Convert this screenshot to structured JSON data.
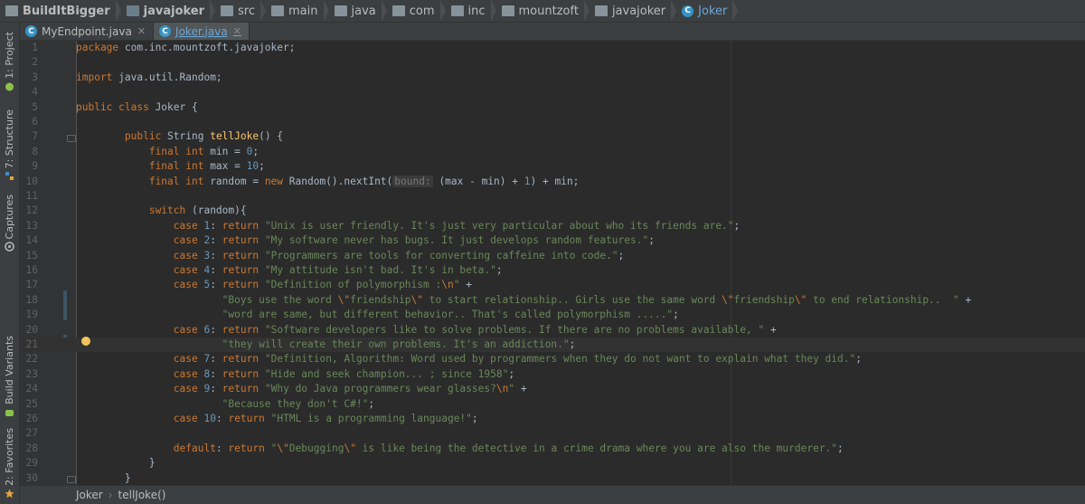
{
  "breadcrumb": [
    {
      "label": "BuildItBigger",
      "icon": "project-folder-icon",
      "bold": true
    },
    {
      "label": "javajoker",
      "icon": "module-folder-icon",
      "bold": true
    },
    {
      "label": "src",
      "icon": "folder-icon"
    },
    {
      "label": "main",
      "icon": "folder-icon"
    },
    {
      "label": "java",
      "icon": "folder-icon"
    },
    {
      "label": "com",
      "icon": "folder-icon"
    },
    {
      "label": "inc",
      "icon": "folder-icon"
    },
    {
      "label": "mountzoft",
      "icon": "package-folder-icon"
    },
    {
      "label": "javajoker",
      "icon": "package-folder-icon"
    },
    {
      "label": "Joker",
      "icon": "class-icon"
    }
  ],
  "side_tabs": [
    "1: Project",
    "7: Structure",
    "Captures",
    "Build Variants",
    "2: Favorites"
  ],
  "tabs": [
    {
      "label": "MyEndpoint.java",
      "active": false
    },
    {
      "label": "Joker.java",
      "active": true
    }
  ],
  "editor": {
    "lines": [
      {
        "n": "1",
        "html": "<span class=\"kw\">package</span> com.inc.mountzoft.javajoker;"
      },
      {
        "n": "2",
        "html": ""
      },
      {
        "n": "3",
        "html": "<span class=\"kw\">import</span> java.util.Random;"
      },
      {
        "n": "4",
        "html": ""
      },
      {
        "n": "5",
        "html": "<span class=\"kw\">public class</span> Joker {"
      },
      {
        "n": "6",
        "html": ""
      },
      {
        "n": "7",
        "html": "        <span class=\"kw\">public</span> String <span class=\"fn\">tellJoke</span>() {"
      },
      {
        "n": "8",
        "html": "            <span class=\"kw\">final int</span> min = <span class=\"num\">0</span>;"
      },
      {
        "n": "9",
        "html": "            <span class=\"kw\">final int</span> max = <span class=\"num\">10</span>;"
      },
      {
        "n": "10",
        "html": "            <span class=\"kw\">final int</span> random = <span class=\"kw\">new</span> Random().nextInt(<span class=\"hint\">bound:</span> (max - min) + <span class=\"num\">1</span>) + min;"
      },
      {
        "n": "11",
        "html": ""
      },
      {
        "n": "12",
        "html": "            <span class=\"kw\">switch</span> (random){"
      },
      {
        "n": "13",
        "html": "                <span class=\"kw\">case</span> <span class=\"num\">1</span>: <span class=\"kw\">return</span> <span class=\"str\">\"Unix is user friendly. It's just very particular about who its friends are.\"</span>;"
      },
      {
        "n": "14",
        "html": "                <span class=\"kw\">case</span> <span class=\"num\">2</span>: <span class=\"kw\">return</span> <span class=\"str\">\"My software never has bugs. It just develops random features.\"</span>;"
      },
      {
        "n": "15",
        "html": "                <span class=\"kw\">case</span> <span class=\"num\">3</span>: <span class=\"kw\">return</span> <span class=\"str\">\"Programmers are tools for converting caffeine into code.\"</span>;"
      },
      {
        "n": "16",
        "html": "                <span class=\"kw\">case</span> <span class=\"num\">4</span>: <span class=\"kw\">return</span> <span class=\"str\">\"My attitude isn't bad. It's in beta.\"</span>;"
      },
      {
        "n": "17",
        "html": "                <span class=\"kw\">case</span> <span class=\"num\">5</span>: <span class=\"kw\">return</span> <span class=\"str\">\"Definition of polymorphism :</span><span class=\"kw\">\\n</span><span class=\"str\">\"</span> +"
      },
      {
        "n": "18",
        "html": "                        <span class=\"str\">\"Boys use the word </span><span class=\"kw\">\\\"</span><span class=\"str\">friendship</span><span class=\"kw\">\\\"</span><span class=\"str\"> to start relationship.. Girls use the same word </span><span class=\"kw\">\\\"</span><span class=\"str\">friendship</span><span class=\"kw\">\\\"</span><span class=\"str\"> to end relationship..  \"</span> +"
      },
      {
        "n": "19",
        "html": "                        <span class=\"str\">\"word are same, but different behavior.. That's called polymorphism .....\"</span>;"
      },
      {
        "n": "20",
        "html": "                <span class=\"kw\">case</span> <span class=\"num\">6</span>: <span class=\"kw\">return</span> <span class=\"str\">\"Software developers like to solve problems. If there are no problems available, \"</span> +"
      },
      {
        "n": "21",
        "html": "                        <span class=\"str\">\"they will create their own problems. It's an addiction.\"</span>;"
      },
      {
        "n": "22",
        "html": "                <span class=\"kw\">case</span> <span class=\"num\">7</span>: <span class=\"kw\">return</span> <span class=\"str\">\"Definition, Algorithm: Word used by programmers when they do not want to explain what they did.\"</span>;"
      },
      {
        "n": "23",
        "html": "                <span class=\"kw\">case</span> <span class=\"num\">8</span>: <span class=\"kw\">return</span> <span class=\"str\">\"Hide and seek champion... ; since 1958\"</span>;"
      },
      {
        "n": "24",
        "html": "                <span class=\"kw\">case</span> <span class=\"num\">9</span>: <span class=\"kw\">return</span> <span class=\"str\">\"Why do Java programmers wear glasses?</span><span class=\"kw\">\\n</span><span class=\"str\">\"</span> +"
      },
      {
        "n": "25",
        "html": "                        <span class=\"str\">\"Because they don't C#!\"</span>;"
      },
      {
        "n": "26",
        "html": "                <span class=\"kw\">case</span> <span class=\"num\">10</span>: <span class=\"kw\">return</span> <span class=\"str\">\"HTML is a programming language!\"</span>;"
      },
      {
        "n": "27",
        "html": ""
      },
      {
        "n": "28",
        "html": "                <span class=\"kw\">default</span>: <span class=\"kw\">return</span> <span class=\"str\">\"</span><span class=\"kw\">\\\"</span><span class=\"str\">Debugging</span><span class=\"kw\">\\\"</span><span class=\"str\"> is like being the detective in a crime drama where you are also the murderer.\"</span>;"
      },
      {
        "n": "29",
        "html": "            }"
      },
      {
        "n": "30",
        "html": "        }"
      }
    ],
    "current_line": "21"
  },
  "status_bar": {
    "class_name": "Joker",
    "method_name": "tellJoke()"
  },
  "colors": {
    "keyword": "#cc7832",
    "string": "#6a8759",
    "number": "#6897bb",
    "method": "#ffc66d",
    "text": "#a9b7c6",
    "background": "#2b2b2b"
  }
}
